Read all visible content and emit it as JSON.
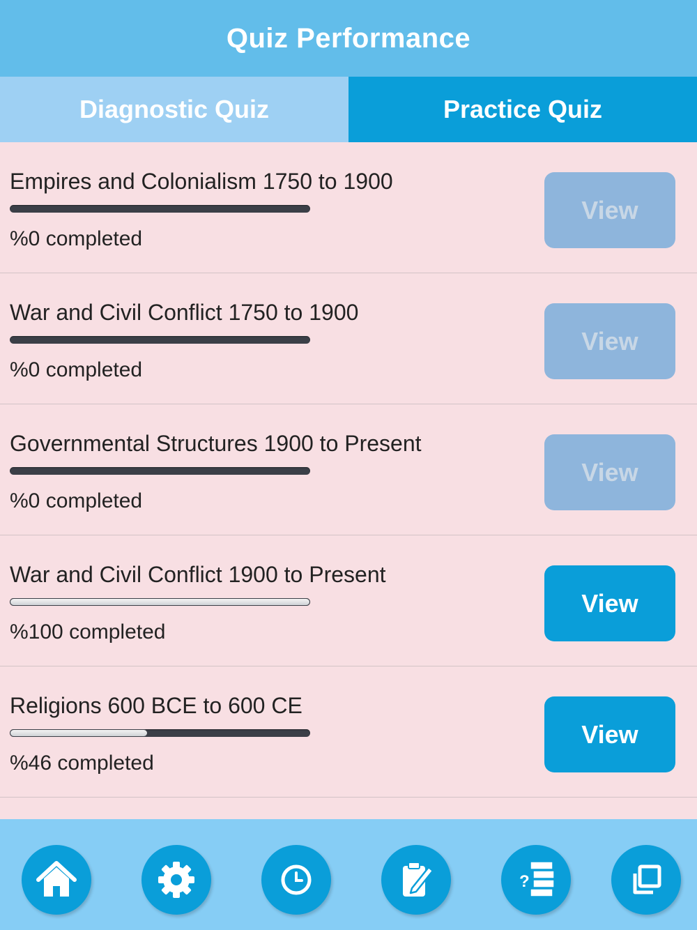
{
  "header": {
    "title": "Quiz Performance"
  },
  "tabs": [
    {
      "label": "Diagnostic Quiz"
    },
    {
      "label": "Practice Quiz"
    }
  ],
  "quizzes": [
    {
      "title": "Empires and Colonialism 1750 to 1900",
      "status": "%0 completed",
      "progress": 0,
      "button_label": "View",
      "button_enabled": false
    },
    {
      "title": "War and Civil Conflict 1750 to 1900",
      "status": "%0 completed",
      "progress": 0,
      "button_label": "View",
      "button_enabled": false
    },
    {
      "title": "Governmental Structures 1900 to Present",
      "status": "%0 completed",
      "progress": 0,
      "button_label": "View",
      "button_enabled": false
    },
    {
      "title": "War and Civil Conflict 1900 to Present",
      "status": "%100 completed",
      "progress": 100,
      "button_label": "View",
      "button_enabled": true
    },
    {
      "title": "Religions 600 BCE to 600 CE",
      "status": "%46 completed",
      "progress": 46,
      "button_label": "View",
      "button_enabled": true
    }
  ],
  "bottom_nav": [
    {
      "icon": "home-icon"
    },
    {
      "icon": "gear-icon"
    },
    {
      "icon": "clock-icon"
    },
    {
      "icon": "clipboard-edit-icon"
    },
    {
      "icon": "quiz-list-icon"
    },
    {
      "icon": "copy-icon"
    }
  ],
  "colors": {
    "header": "#62bdea",
    "tab_inactive": "#9ed0f3",
    "tab_active": "#0a9ed9",
    "background": "#f8dfe3",
    "button_enabled": "#0a9ed9",
    "button_disabled": "#8eb5dc",
    "bottom_bar": "#86cdf5"
  }
}
